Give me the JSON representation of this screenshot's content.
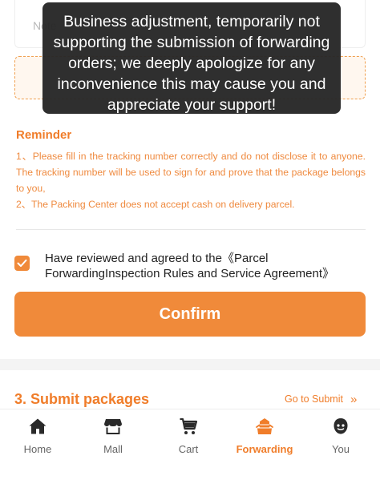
{
  "top_card": {
    "note_placeholder": "Note"
  },
  "toast": {
    "message": "Business adjustment, temporarily not supporting the submission of forwarding orders; we deeply apologize for any inconvenience this may cause you and appreciate your support!"
  },
  "reminder": {
    "title": "Reminder",
    "line1": "1、Please fill in the tracking number correctly and do not disclose it to anyone. The tracking number will be used to sign for and prove that the package belongs to you,",
    "line2": "2、The Packing Center does not accept cash on delivery parcel."
  },
  "agreement": {
    "checked": true,
    "text": "Have reviewed and agreed to the《Parcel ForwardingInspection Rules and Service Agreement》"
  },
  "confirm_label": "Confirm",
  "submit_section": {
    "title": "3. Submit packages",
    "link": "Go to Submit",
    "chevron": "»"
  },
  "tabbar": {
    "items": [
      {
        "label": "Home",
        "icon": "home-icon"
      },
      {
        "label": "Mall",
        "icon": "store-icon"
      },
      {
        "label": "Cart",
        "icon": "cart-icon"
      },
      {
        "label": "Forwarding",
        "icon": "forwarding-icon",
        "active": true
      },
      {
        "label": "You",
        "icon": "user-icon"
      }
    ]
  },
  "colors": {
    "accent": "#f08a3a",
    "accent_text": "#f07d2a",
    "toast_bg": "#262626"
  }
}
